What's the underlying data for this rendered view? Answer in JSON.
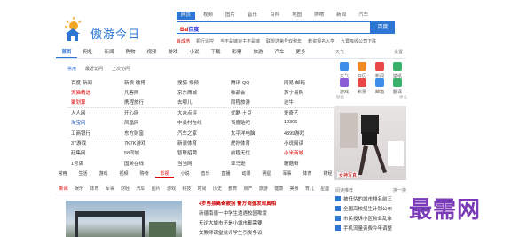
{
  "header": {
    "site_title": "傲游今日"
  },
  "search": {
    "tabs": [
      "网页",
      "视频",
      "图片",
      "音乐",
      "百科",
      "地图",
      "购物",
      "新闻",
      "汽车"
    ],
    "active_tab": 0,
    "engine_label": "百度",
    "button_label": "百度"
  },
  "hot_keywords": [
    "肖成浩",
    "机行遥控",
    "当不是嫁对主不是嫁",
    "联盟选第号双称年",
    "教资报名入学",
    "九霄吸收公司下跌"
  ],
  "nav": {
    "items": [
      "首页",
      "网址",
      "新闻",
      "购物",
      "视频",
      "游戏",
      "小说",
      "下载",
      "彩票",
      "旅游",
      "汽车",
      "更多"
    ],
    "active": 0,
    "right_items": [
      "天气",
      "设置"
    ]
  },
  "directory": {
    "tabs": [
      "常用",
      "最近访问",
      "上次访问"
    ],
    "rows": [
      [
        {
          "t": "百度·新闻"
        },
        {
          "t": "新浪·微博"
        },
        {
          "t": "搜狐·视频"
        },
        {
          "t": "腾讯·QQ"
        },
        {
          "t": "网易·邮箱"
        }
      ],
      [
        {
          "t": "天猫精选",
          "c": "r"
        },
        {
          "t": "凡客网"
        },
        {
          "t": "京东商城"
        },
        {
          "t": "唯品会"
        },
        {
          "t": "苏宁易购"
        }
      ],
      [
        {
          "t": "聚划算",
          "c": "r"
        },
        {
          "t": "携程旅行"
        },
        {
          "t": "去哪儿"
        },
        {
          "t": "同程旅游"
        },
        {
          "t": "途牛"
        }
      ],
      [
        {
          "t": "人人网"
        },
        {
          "t": "开心网"
        },
        {
          "t": "大众点评"
        },
        {
          "t": "优酷·土豆"
        },
        {
          "t": "爱奇艺"
        }
      ],
      [
        {
          "t": "淘宝网",
          "c": "b"
        },
        {
          "t": "凤凰网"
        },
        {
          "t": "中关村在线"
        },
        {
          "t": "百度贴吧"
        },
        {
          "t": "12306"
        }
      ],
      [
        {
          "t": "工商银行"
        },
        {
          "t": "东方财富"
        },
        {
          "t": "汽车之家"
        },
        {
          "t": "太平洋电脑"
        },
        {
          "t": "4399游戏"
        }
      ],
      [
        {
          "t": "37游戏"
        },
        {
          "t": "7K7K游戏"
        },
        {
          "t": "新浪体育"
        },
        {
          "t": "虎扑体育"
        },
        {
          "t": "小说阅读"
        }
      ],
      [
        {
          "t": "赶集网"
        },
        {
          "t": "58同城"
        },
        {
          "t": "智联招聘"
        },
        {
          "t": "前程无忧"
        },
        {
          "t": "小米商城",
          "c": "r"
        }
      ],
      [
        {
          "t": "1号店"
        },
        {
          "t": "国美在线"
        },
        {
          "t": "当当网"
        },
        {
          "t": "亚马逊"
        },
        {
          "t": "蘑菇街"
        }
      ]
    ]
  },
  "category_tabs": [
    "常用",
    "生活",
    "游戏",
    "视频",
    "购物",
    "影视",
    "小说",
    "音乐",
    "直播",
    "动漫",
    "明星",
    "军事",
    "体育",
    "财经",
    "汽车",
    "搞笑"
  ],
  "right_icons": [
    "天气",
    "日历",
    "新闻",
    "壁纸",
    "游戏",
    "彩票",
    "邮箱",
    "翻译"
  ],
  "right_bar": [
    "壁纸",
    "更多"
  ],
  "photo_caption": "女神写真",
  "lower_tabs": [
    "新闻",
    "娱乐",
    "体育",
    "军事",
    "财经",
    "汽车",
    "图片",
    "游戏",
    "科技",
    "时尚",
    "历史",
    "教育",
    "房产",
    "旅游",
    "健康",
    "美食",
    "育儿",
    "星座"
  ],
  "news": {
    "headline": "4岁男孩离奇被拐 警方调查发现真相",
    "items": [
      "新疆南疆一中学生遭遇校园欺凌",
      "无论大城市还是小城市都需要",
      "女教师课堂批评学生引发争议",
      "大熊猫基地新生宝宝亮相了"
    ]
  },
  "right_list": {
    "header": [
      "阅读推荐",
      "换一换"
    ],
    "items": [
      "被低估的城市排名前三",
      "全国高校招生计划公布",
      "市民投诉小区物业乱象",
      "手机流量资费今年调整"
    ]
  },
  "watermark": "最需网"
}
